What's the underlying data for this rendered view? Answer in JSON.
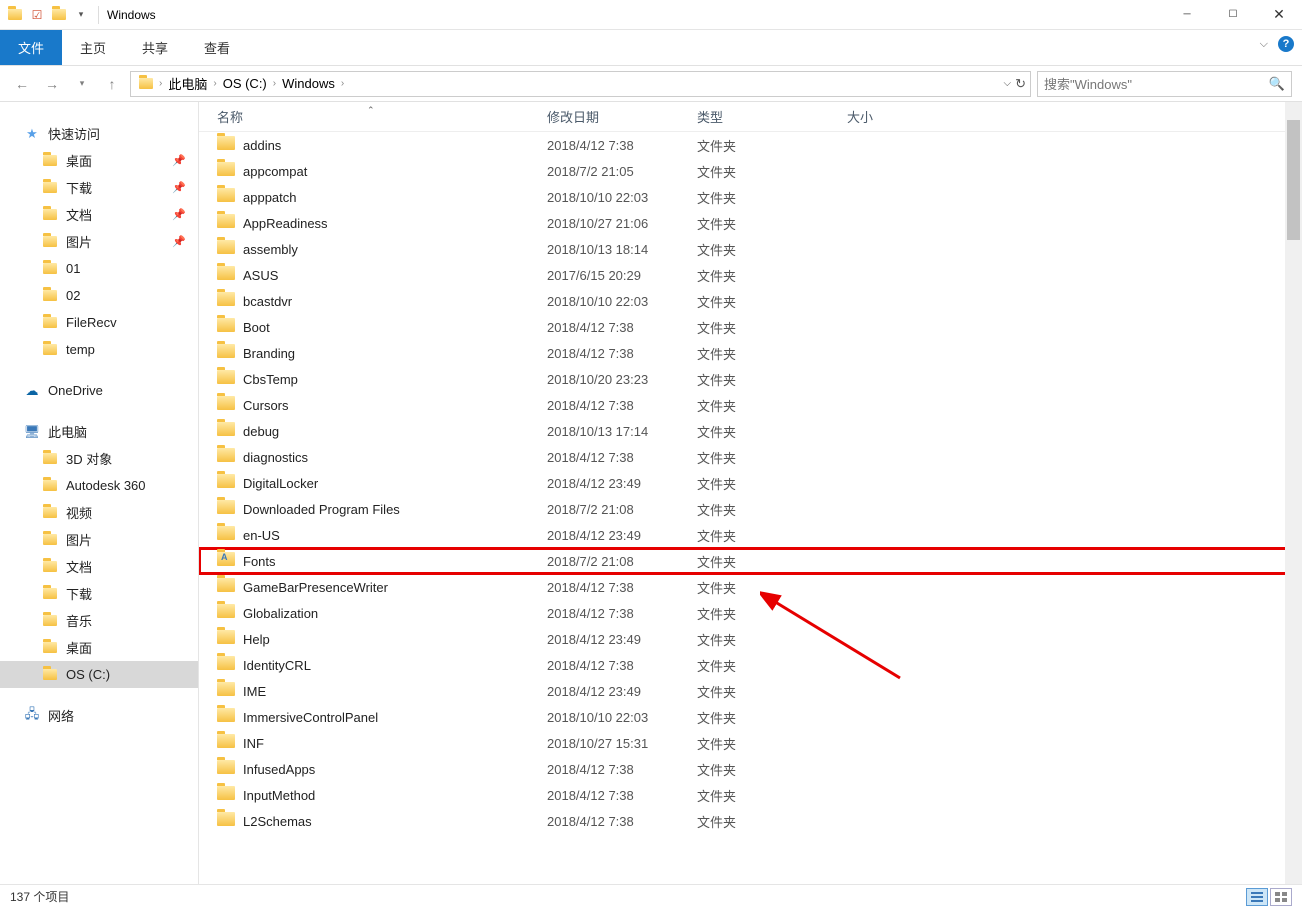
{
  "window": {
    "title": "Windows"
  },
  "ribbon": {
    "file": "文件",
    "home": "主页",
    "share": "共享",
    "view": "查看"
  },
  "breadcrumb": {
    "items": [
      "此电脑",
      "OS (C:)",
      "Windows"
    ]
  },
  "search": {
    "placeholder": "搜索\"Windows\""
  },
  "nav": {
    "quick_access": "快速访问",
    "quick_items": [
      {
        "label": "桌面",
        "pinned": true
      },
      {
        "label": "下载",
        "pinned": true
      },
      {
        "label": "文档",
        "pinned": true
      },
      {
        "label": "图片",
        "pinned": true
      },
      {
        "label": "01",
        "pinned": false
      },
      {
        "label": "02",
        "pinned": false
      },
      {
        "label": "FileRecv",
        "pinned": false
      },
      {
        "label": "temp",
        "pinned": false
      }
    ],
    "onedrive": "OneDrive",
    "this_pc": "此电脑",
    "pc_items": [
      {
        "label": "3D 对象"
      },
      {
        "label": "Autodesk 360"
      },
      {
        "label": "视频"
      },
      {
        "label": "图片"
      },
      {
        "label": "文档"
      },
      {
        "label": "下载"
      },
      {
        "label": "音乐"
      },
      {
        "label": "桌面"
      },
      {
        "label": "OS (C:)",
        "selected": true
      }
    ],
    "network": "网络"
  },
  "cols": {
    "name": "名称",
    "date": "修改日期",
    "type": "类型",
    "size": "大小"
  },
  "files": [
    {
      "name": "addins",
      "date": "2018/4/12 7:38",
      "type": "文件夹"
    },
    {
      "name": "appcompat",
      "date": "2018/7/2 21:05",
      "type": "文件夹"
    },
    {
      "name": "apppatch",
      "date": "2018/10/10 22:03",
      "type": "文件夹"
    },
    {
      "name": "AppReadiness",
      "date": "2018/10/27 21:06",
      "type": "文件夹"
    },
    {
      "name": "assembly",
      "date": "2018/10/13 18:14",
      "type": "文件夹"
    },
    {
      "name": "ASUS",
      "date": "2017/6/15 20:29",
      "type": "文件夹"
    },
    {
      "name": "bcastdvr",
      "date": "2018/10/10 22:03",
      "type": "文件夹"
    },
    {
      "name": "Boot",
      "date": "2018/4/12 7:38",
      "type": "文件夹"
    },
    {
      "name": "Branding",
      "date": "2018/4/12 7:38",
      "type": "文件夹"
    },
    {
      "name": "CbsTemp",
      "date": "2018/10/20 23:23",
      "type": "文件夹"
    },
    {
      "name": "Cursors",
      "date": "2018/4/12 7:38",
      "type": "文件夹"
    },
    {
      "name": "debug",
      "date": "2018/10/13 17:14",
      "type": "文件夹"
    },
    {
      "name": "diagnostics",
      "date": "2018/4/12 7:38",
      "type": "文件夹"
    },
    {
      "name": "DigitalLocker",
      "date": "2018/4/12 23:49",
      "type": "文件夹"
    },
    {
      "name": "Downloaded Program Files",
      "date": "2018/7/2 21:08",
      "type": "文件夹"
    },
    {
      "name": "en-US",
      "date": "2018/4/12 23:49",
      "type": "文件夹"
    },
    {
      "name": "Fonts",
      "date": "2018/7/2 21:08",
      "type": "文件夹",
      "highlight": true,
      "fonticon": true
    },
    {
      "name": "GameBarPresenceWriter",
      "date": "2018/4/12 7:38",
      "type": "文件夹"
    },
    {
      "name": "Globalization",
      "date": "2018/4/12 7:38",
      "type": "文件夹"
    },
    {
      "name": "Help",
      "date": "2018/4/12 23:49",
      "type": "文件夹"
    },
    {
      "name": "IdentityCRL",
      "date": "2018/4/12 7:38",
      "type": "文件夹"
    },
    {
      "name": "IME",
      "date": "2018/4/12 23:49",
      "type": "文件夹"
    },
    {
      "name": "ImmersiveControlPanel",
      "date": "2018/10/10 22:03",
      "type": "文件夹"
    },
    {
      "name": "INF",
      "date": "2018/10/27 15:31",
      "type": "文件夹"
    },
    {
      "name": "InfusedApps",
      "date": "2018/4/12 7:38",
      "type": "文件夹"
    },
    {
      "name": "InputMethod",
      "date": "2018/4/12 7:38",
      "type": "文件夹"
    },
    {
      "name": "L2Schemas",
      "date": "2018/4/12 7:38",
      "type": "文件夹"
    }
  ],
  "status": {
    "count": "137 个项目"
  }
}
